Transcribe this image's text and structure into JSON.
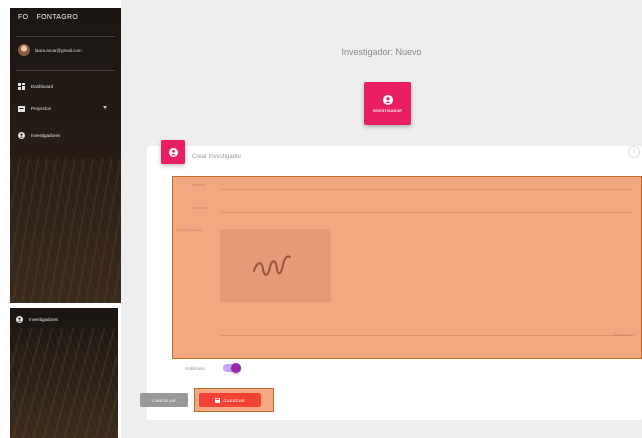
{
  "sidebar": {
    "brand_short": "FO",
    "brand_name": "FONTAGRO",
    "user_email": "laura.arcar@gmail.com",
    "items": [
      {
        "label": "Dashboard",
        "icon": "dashboard-icon"
      },
      {
        "label": "Proyectos",
        "icon": "folder-icon"
      },
      {
        "label": "Investigadores",
        "icon": "person-icon"
      }
    ]
  },
  "sidebar_zoom": {
    "item_label": "Investigadores",
    "icon": "person-icon"
  },
  "page": {
    "title": "Investigador: Nuevo",
    "big_button_label": "INVESTIGADOR"
  },
  "form": {
    "card_title": "Crear Investigador",
    "fields": {
      "apellido": "Apellido",
      "nombre": "Nombre",
      "photo": "Foto Personal",
      "photo_hint": "Seleccione..."
    },
    "toggle_label": "Habilitado",
    "toggle_on": true,
    "cancel_label": "CANCELAR",
    "save_label": "GUARDAR"
  },
  "colors": {
    "primary": "#e91e63",
    "save": "#f44336",
    "toggle": "#9c27b0",
    "highlight": "#f2a982",
    "highlight_border": "#c26a2c"
  }
}
